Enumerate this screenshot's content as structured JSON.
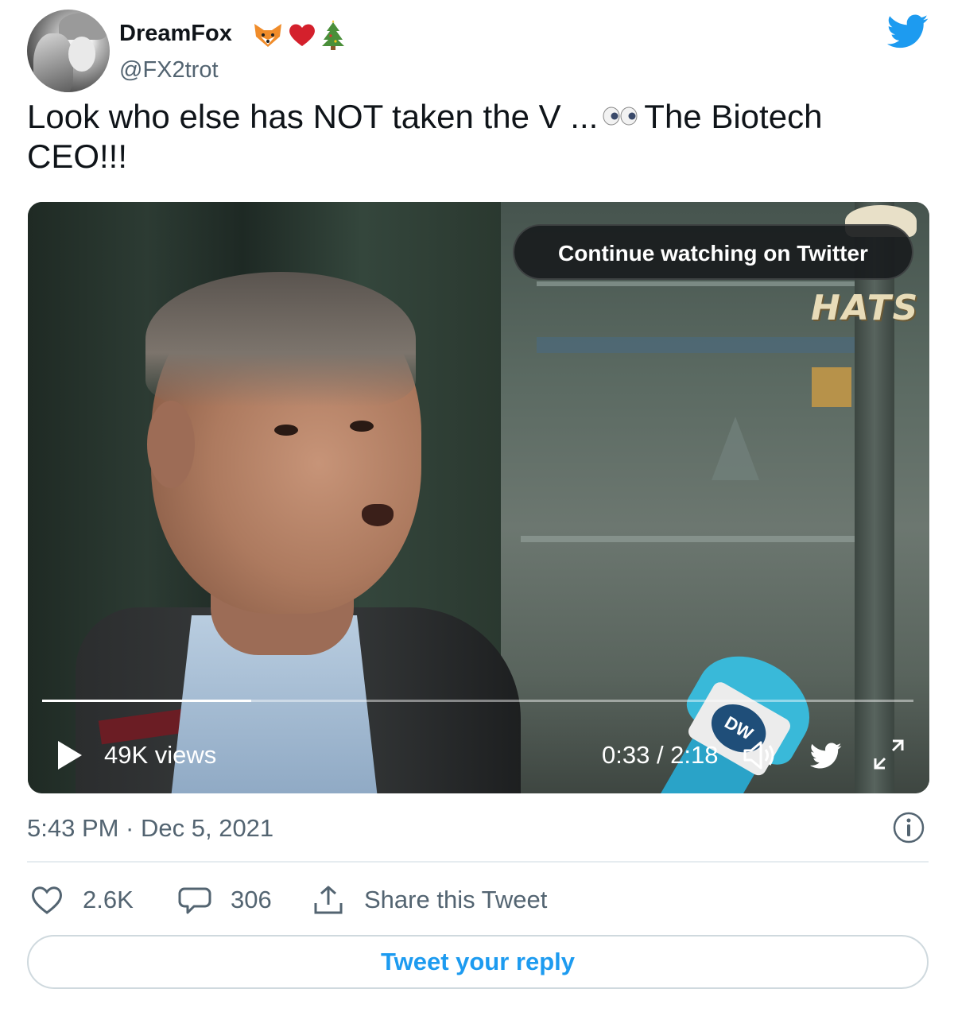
{
  "author": {
    "name": "DreamFox",
    "handle": "@FX2trot",
    "name_emojis": [
      "fox-face",
      "red-heart",
      "christmas-tree"
    ]
  },
  "tweet": {
    "text_before": "Look who else has NOT taken the V ...",
    "text_after": "The Biotech CEO!!!",
    "inline_emoji": "eyes"
  },
  "video": {
    "overlay_button": "Continue watching on Twitter",
    "scene_sign": "HATS",
    "mic_logo": "DW",
    "views": "49K views",
    "time": "0:33 / 2:18",
    "progress": 0.24
  },
  "meta": {
    "timestamp": "5:43 PM · Dec 5, 2021"
  },
  "actions": {
    "likes": "2.6K",
    "replies": "306",
    "share_label": "Share this Tweet",
    "reply_button": "Tweet your reply"
  },
  "colors": {
    "twitter_blue": "#1d9bf0",
    "secondary_text": "#536471",
    "primary_text": "#0f1419"
  }
}
